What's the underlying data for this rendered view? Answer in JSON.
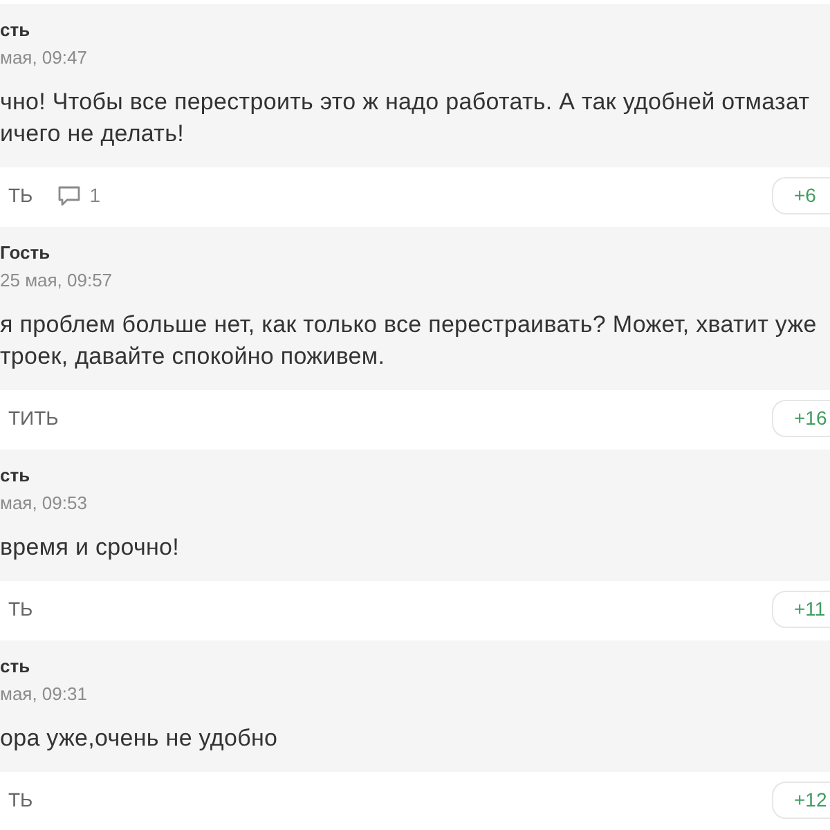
{
  "comments": [
    {
      "author": "сть",
      "date": "мая, 09:47",
      "lines": [
        "чно! Чтобы все перестроить это ж надо работать. А так удобней отмазат",
        "ичего не делать!"
      ],
      "reply": "ТЬ",
      "replies_count": "1",
      "votes": "+6"
    },
    {
      "author": "Гость",
      "date": "25 мая, 09:57",
      "lines": [
        "я проблем больше нет, как только все перестраивать? Может, хватит уже",
        "троек, давайте спокойно поживем."
      ],
      "reply": "ТИТЬ",
      "votes": "+16"
    },
    {
      "author": "сть",
      "date": "мая, 09:53",
      "lines": [
        "время и срочно!"
      ],
      "reply": "ТЬ",
      "votes": "+11"
    },
    {
      "author": "сть",
      "date": "мая, 09:31",
      "lines": [
        "ора уже,очень не удобно"
      ],
      "reply": "ТЬ",
      "votes": "+12"
    }
  ]
}
